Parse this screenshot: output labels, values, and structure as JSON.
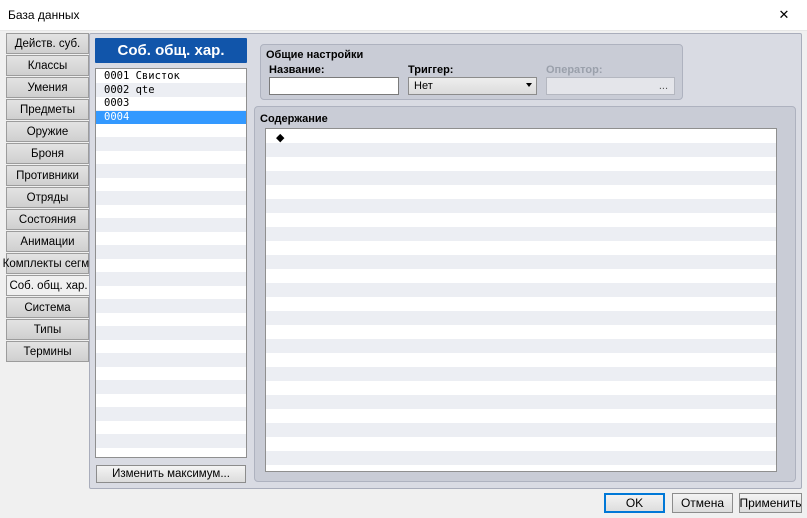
{
  "window": {
    "title": "База данных",
    "close_glyph": "✕"
  },
  "tabs": [
    {
      "label": "Действ. суб.",
      "active": false
    },
    {
      "label": "Классы",
      "active": false
    },
    {
      "label": "Умения",
      "active": false
    },
    {
      "label": "Предметы",
      "active": false
    },
    {
      "label": "Оружие",
      "active": false
    },
    {
      "label": "Броня",
      "active": false
    },
    {
      "label": "Противники",
      "active": false
    },
    {
      "label": "Отряды",
      "active": false
    },
    {
      "label": "Состояния",
      "active": false
    },
    {
      "label": "Анимации",
      "active": false
    },
    {
      "label": "Комплекты сегм.",
      "active": false
    },
    {
      "label": "Соб. общ. хар.",
      "active": true
    },
    {
      "label": "Система",
      "active": false
    },
    {
      "label": "Типы",
      "active": false
    },
    {
      "label": "Термины",
      "active": false
    }
  ],
  "list": {
    "header": "Соб. общ. хар.",
    "items": [
      {
        "label": "0001 Свисток",
        "selected": false
      },
      {
        "label": "0002 qte",
        "selected": false
      },
      {
        "label": "0003",
        "selected": false
      },
      {
        "label": "0004",
        "selected": true
      }
    ],
    "max_button": "Изменить максимум..."
  },
  "settings": {
    "group_title": "Общие настройки",
    "name_label": "Название:",
    "name_value": "",
    "trigger_label": "Триггер:",
    "trigger_value": "Нет",
    "operator_label": "Оператор:",
    "operator_button": "..."
  },
  "content": {
    "group_title": "Содержание",
    "marker": "◆"
  },
  "buttons": {
    "ok": "OK",
    "cancel": "Отмена",
    "apply": "Применить"
  },
  "colors": {
    "selection": "#3399ff",
    "header_bg": "#1155aa",
    "ok_border": "#0078d7"
  }
}
